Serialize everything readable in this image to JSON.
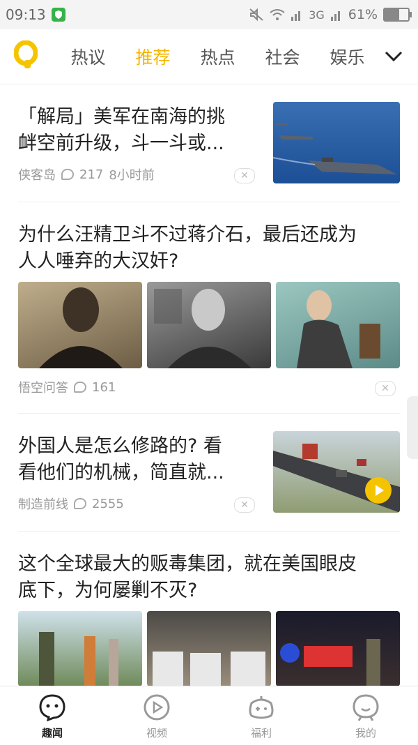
{
  "status_bar": {
    "time": "09:13",
    "network": "3G",
    "battery": "61%",
    "battery_level": 0.61
  },
  "header": {
    "logo_letter": "Q",
    "tabs": [
      {
        "label": "热议"
      },
      {
        "label": "推荐"
      },
      {
        "label": "热点"
      },
      {
        "label": "社会"
      },
      {
        "label": "娱乐"
      }
    ],
    "active_tab": "推荐"
  },
  "feed": {
    "items": [
      {
        "title_line1": "「解局」美军在南海的挑",
        "title_line2": "衅空前升级，斗一斗或...",
        "source": "侠客岛",
        "comments": "217",
        "time": "8小时前",
        "thumb": "aircraft-carrier-photo"
      },
      {
        "title_line1": "为什么汪精卫斗不过蒋介石，最后还成为",
        "title_line2": "人人唾弃的大汉奸?",
        "source": "悟空问答",
        "comments": "161",
        "thumbs": [
          "portrait-photo-1",
          "portrait-photo-2",
          "portrait-photo-3"
        ]
      },
      {
        "title_line1": "外国人是怎么修路的? 看",
        "title_line2": "看他们的机械，简直就...",
        "source": "制造前线",
        "comments": "2555",
        "thumb": "road-construction-video"
      },
      {
        "title_line1": "这个全球最大的贩毒集团，就在美国眼皮",
        "title_line2": "底下，为何屡剿不灭?",
        "thumbs": [
          "soldiers-street-photo",
          "protest-crowd-photo",
          "night-police-photo"
        ]
      }
    ],
    "dismiss_symbol": "✕"
  },
  "bottom_nav": {
    "items": [
      {
        "label": "趣闻",
        "icon": "face-icon"
      },
      {
        "label": "视频",
        "icon": "play-circle-icon"
      },
      {
        "label": "福利",
        "icon": "gamepad-icon"
      },
      {
        "label": "我的",
        "icon": "profile-face-icon"
      }
    ],
    "active": "趣闻"
  },
  "colors": {
    "accent": "#f5b400",
    "text": "#222222",
    "meta": "#999999"
  }
}
